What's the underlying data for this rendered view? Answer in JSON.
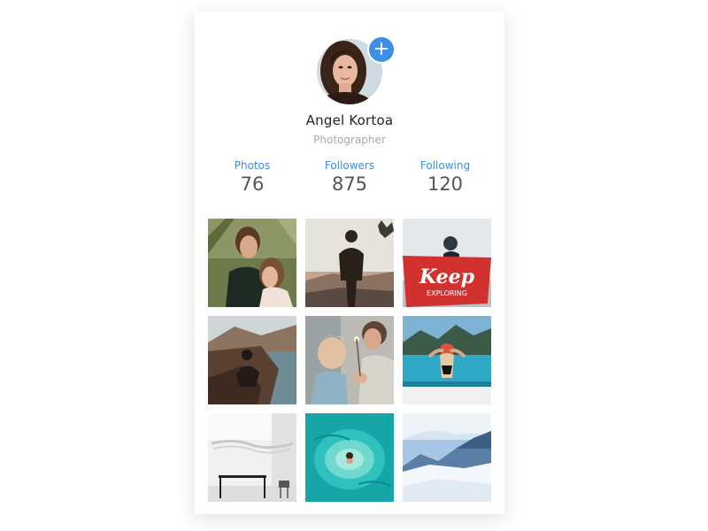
{
  "profile": {
    "name": "Angel Kortoa",
    "role": "Photographer",
    "add_icon": "plus-icon"
  },
  "stats": [
    {
      "label": "Photos",
      "value": "76"
    },
    {
      "label": "Followers",
      "value": "875"
    },
    {
      "label": "Following",
      "value": "120"
    }
  ],
  "photos": [
    {
      "text": ""
    },
    {
      "text": ""
    },
    {
      "text": "Keep",
      "subtext": "EXPLORING"
    },
    {
      "text": ""
    },
    {
      "text": ""
    },
    {
      "text": ""
    },
    {
      "text": ""
    },
    {
      "text": ""
    },
    {
      "text": ""
    }
  ],
  "colors": {
    "accent": "#3d8ee6",
    "name_text": "#222222",
    "muted_text": "#a9a9a9",
    "stat_value": "#555555"
  }
}
